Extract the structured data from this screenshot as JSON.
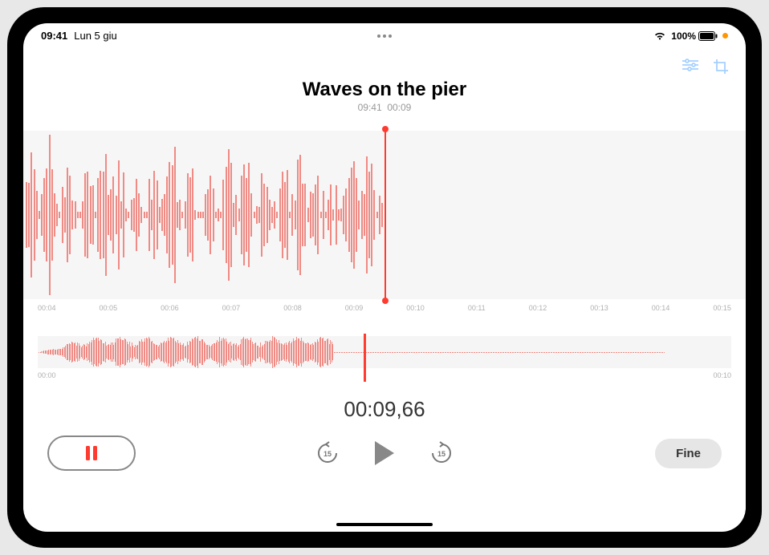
{
  "status": {
    "time": "09:41",
    "date": "Lun 5 giu",
    "battery": "100%"
  },
  "recording": {
    "title": "Waves on the pier",
    "metaTime": "09:41",
    "metaDuration": "00:09"
  },
  "timeline": {
    "ticks": [
      "00:04",
      "00:05",
      "00:06",
      "00:07",
      "00:08",
      "00:09",
      "00:10",
      "00:11",
      "00:12",
      "00:13",
      "00:14",
      "00:15"
    ]
  },
  "overview": {
    "start": "00:00",
    "end": "00:10"
  },
  "playback": {
    "currentTime": "00:09,66"
  },
  "buttons": {
    "done": "Fine"
  },
  "skip": {
    "back": "15",
    "forward": "15"
  }
}
